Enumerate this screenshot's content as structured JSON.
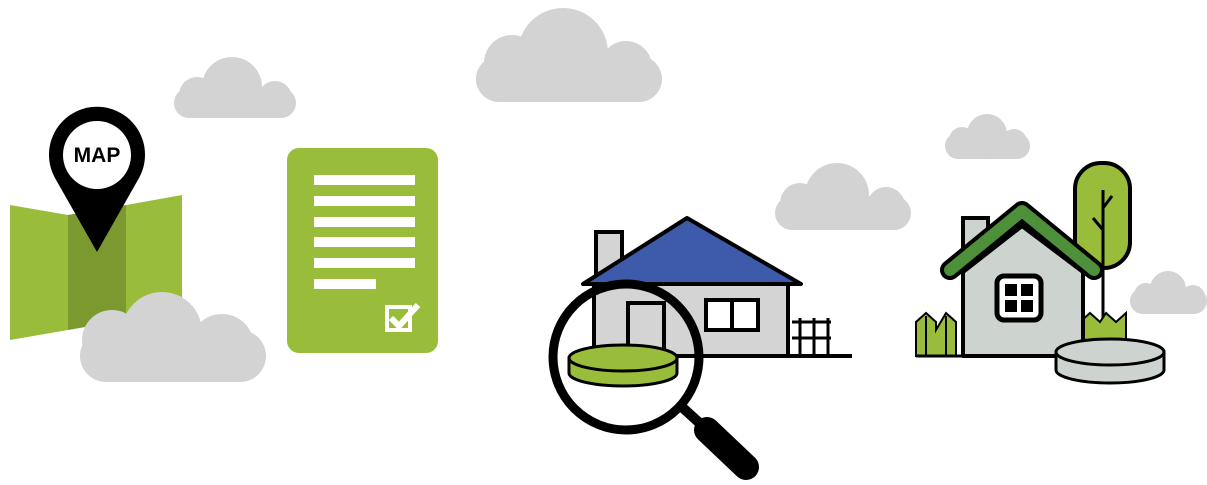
{
  "pin": {
    "label": "MAP"
  },
  "icons": [
    "cloud-icon",
    "folded-map-icon",
    "location-pin-icon",
    "document-icon",
    "checkbox-icon",
    "house-icon",
    "magnifying-glass-icon",
    "tree-icon",
    "fence-icon",
    "disc-platform-icon"
  ],
  "colors": {
    "cloud": "#d3d3d3",
    "green": "#99bd3b",
    "dark_green": "#7c9930",
    "house_green_roof": "#4e8f3a",
    "roof_blue": "#3d5aab",
    "wall_gray": "#d4d4d4",
    "house_light_gray": "#cdd3cf",
    "outline": "#000000"
  }
}
